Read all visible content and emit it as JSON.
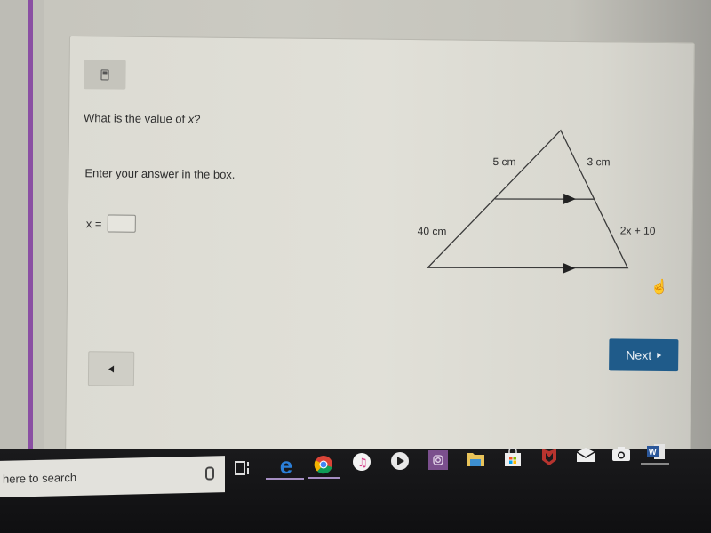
{
  "question": {
    "prompt_prefix": "What is the value of ",
    "prompt_var": "x",
    "prompt_suffix": "?",
    "instruction": "Enter your answer in the box.",
    "answer_label": "x =",
    "answer_value": ""
  },
  "figure": {
    "label_top_left": "5 cm",
    "label_top_right": "3 cm",
    "label_bottom_left": "40 cm",
    "label_bottom_right": "2x + 10"
  },
  "buttons": {
    "calculator": "calculator",
    "back": "back",
    "next_label": "Next"
  },
  "taskbar": {
    "search_placeholder": "here to search",
    "apps": [
      "task-view",
      "edge",
      "chrome",
      "itunes",
      "media-player",
      "instagram",
      "file-explorer",
      "store",
      "mcafee",
      "mail",
      "camera",
      "word"
    ]
  },
  "colors": {
    "accent_purple": "#8a4fa3",
    "next_button": "#1f5b8a"
  }
}
